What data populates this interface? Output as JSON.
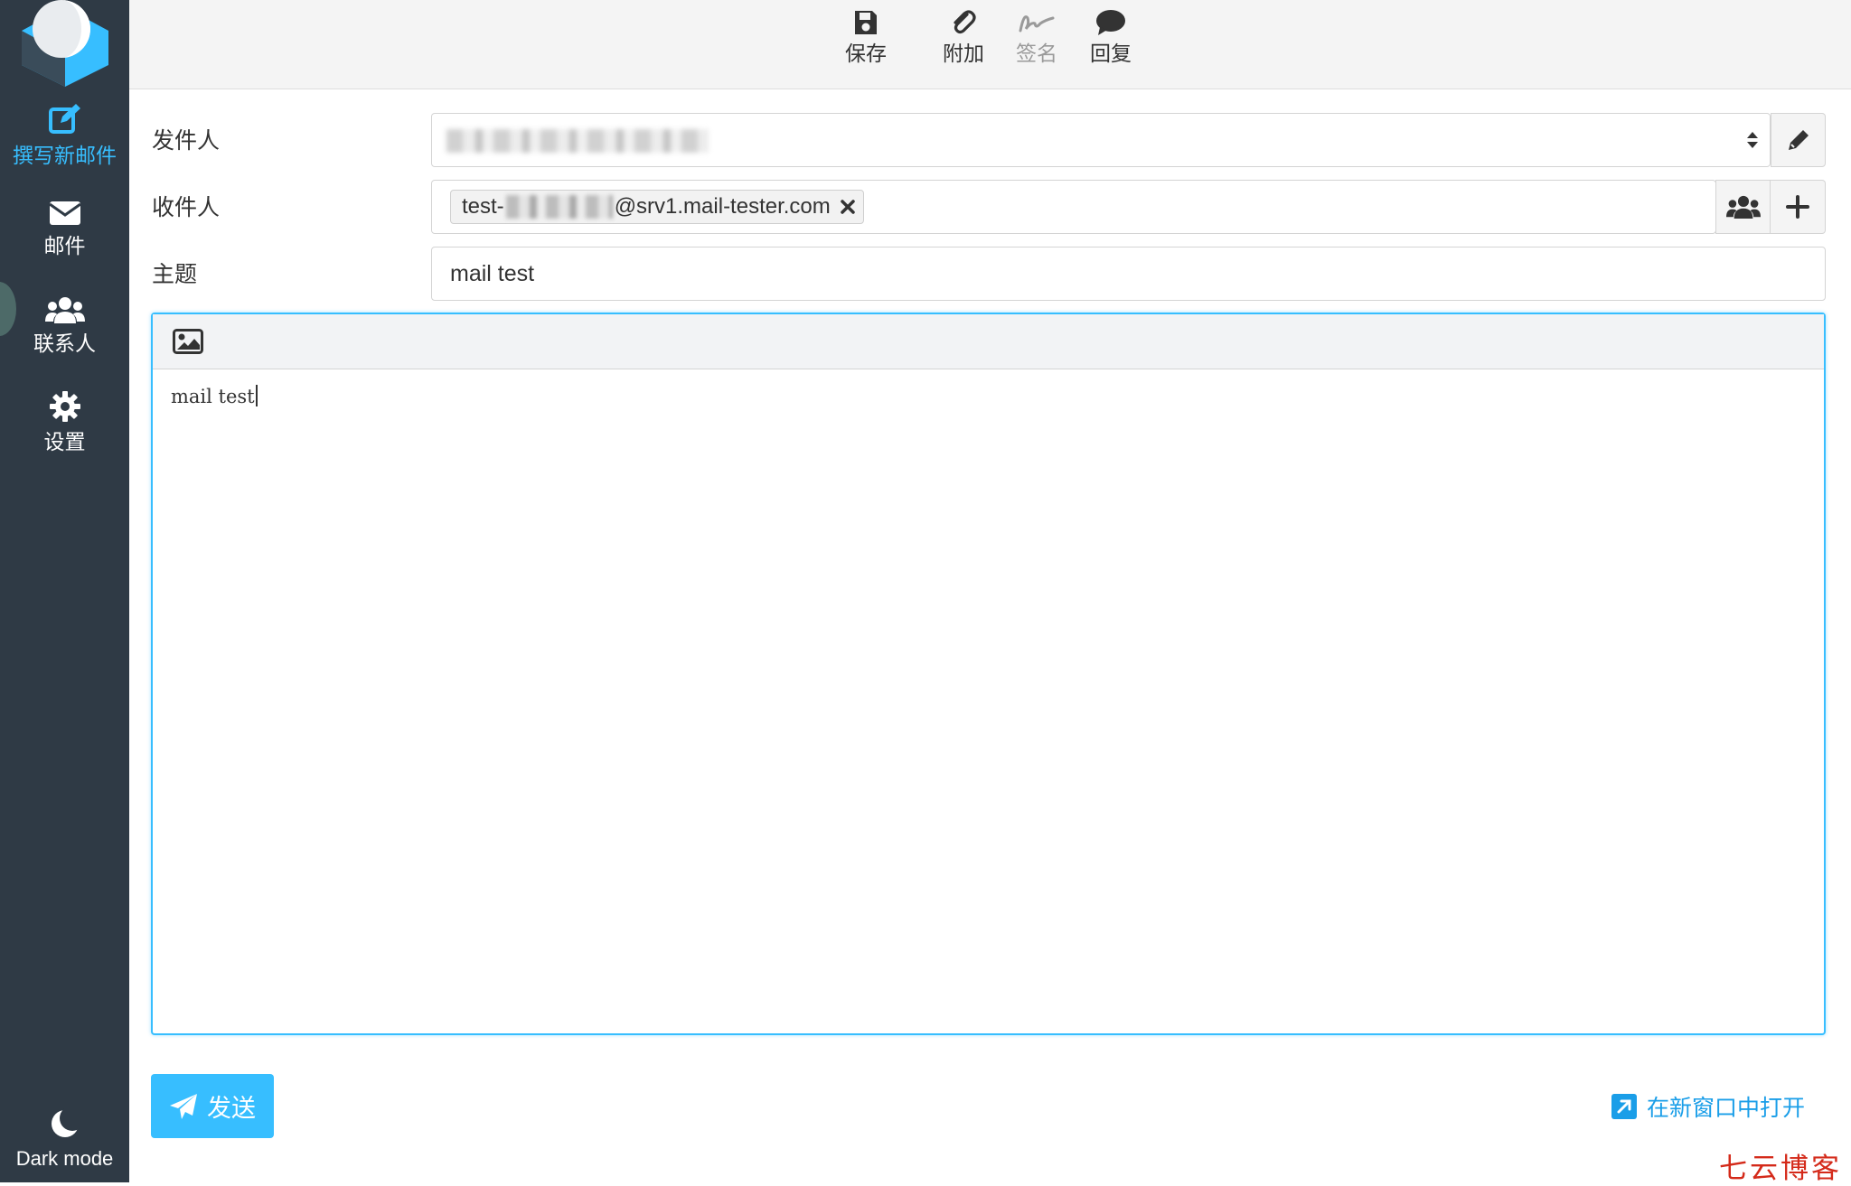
{
  "sidebar": {
    "items": [
      {
        "label": "撰写新邮件",
        "icon": "compose-icon",
        "active": true
      },
      {
        "label": "邮件",
        "icon": "envelope-icon",
        "active": false
      },
      {
        "label": "联系人",
        "icon": "users-icon",
        "active": false
      },
      {
        "label": "设置",
        "icon": "gear-icon",
        "active": false
      }
    ],
    "dark_mode_label": "Dark mode"
  },
  "toolbar": {
    "save_label": "保存",
    "attach_label": "附加",
    "signature_label": "签名",
    "reply_label": "回复"
  },
  "form": {
    "from_label": "发件人",
    "to_label": "收件人",
    "recipient_prefix": "test-",
    "recipient_suffix": "@srv1.mail-tester.com",
    "subject_label": "主题",
    "subject_value": "mail test"
  },
  "editor": {
    "body_text": "mail test"
  },
  "footer": {
    "send_label": "发送",
    "open_new_window_label": "在新窗口中打开"
  },
  "watermark": "七云博客",
  "colors": {
    "sidebar_bg": "#2f3a45",
    "accent": "#37beff",
    "link": "#1a9ee8",
    "watermark": "#d42a1a"
  }
}
